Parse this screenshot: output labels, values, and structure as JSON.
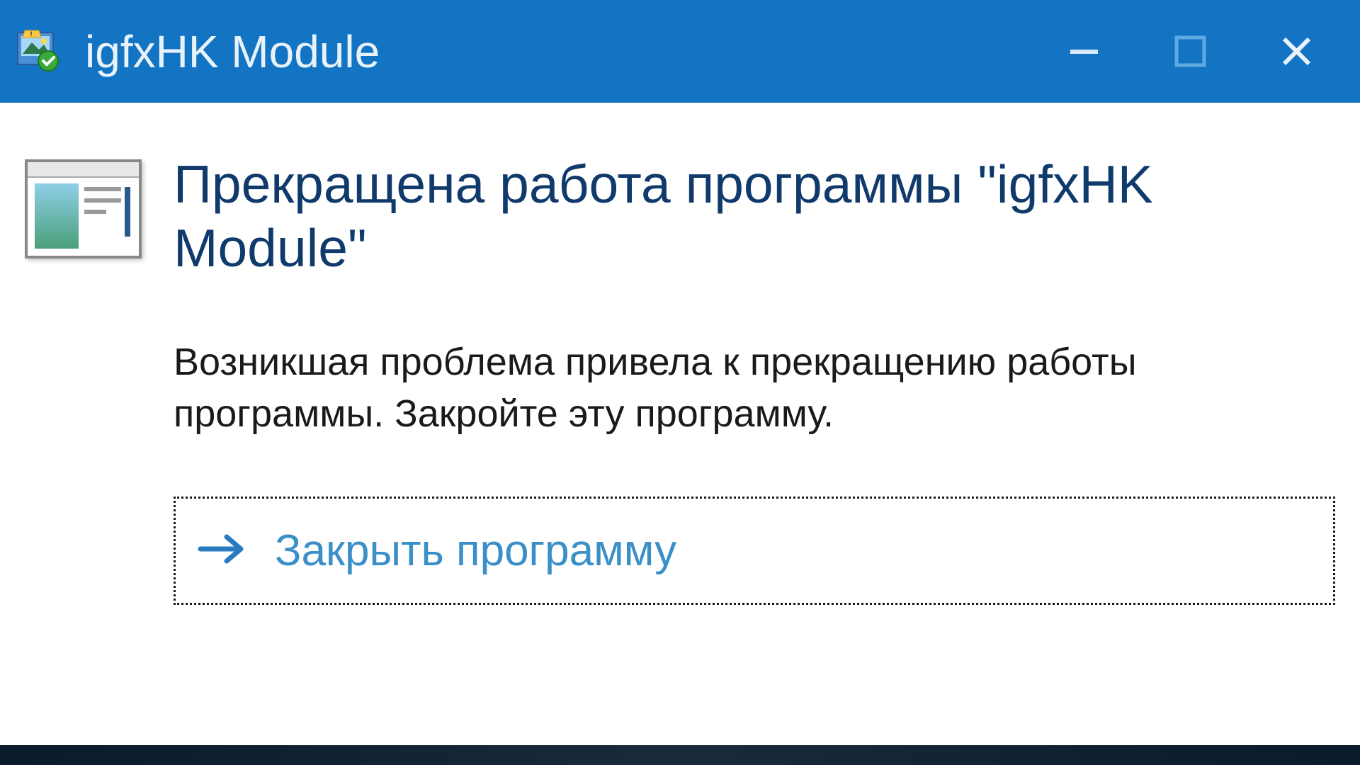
{
  "titlebar": {
    "title": "igfxHK Module"
  },
  "content": {
    "heading": "Прекращена работа программы \"igfxHK Module\"",
    "description": "Возникшая проблема привела к прекращению работы программы. Закройте эту программу."
  },
  "action": {
    "close_program_label": "Закрыть программу"
  },
  "colors": {
    "titlebar_bg": "#1474c4",
    "heading_color": "#0f3a6b",
    "link_color": "#3a8fc8"
  }
}
